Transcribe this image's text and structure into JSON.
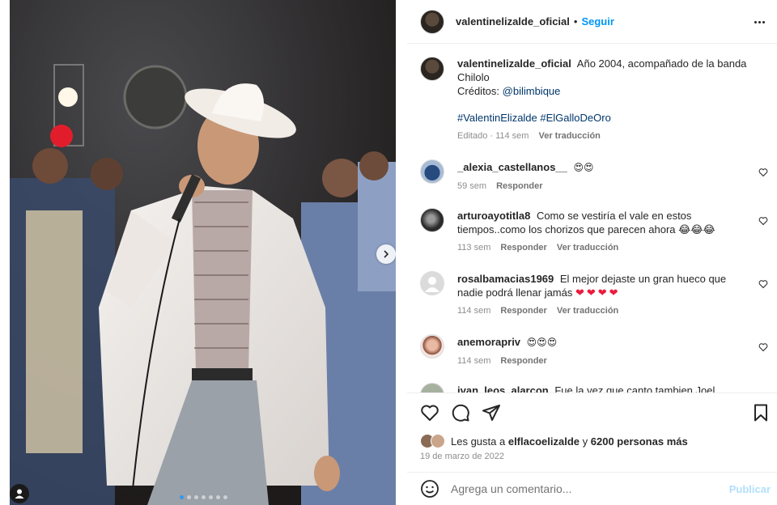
{
  "post": {
    "username": "valentinelizalde_oficial",
    "separator": "•",
    "follow_label": "Seguir"
  },
  "caption": {
    "username": "valentinelizalde_oficial",
    "text": "Año 2004, acompañado de la banda Chilolo",
    "credits_prefix": "Créditos:",
    "credits_handle": "@bilimbique",
    "hashtags": "#ValentinElizalde #ElGalloDeOro",
    "meta_time": "Editado · 114 sem",
    "meta_translate": "Ver traducción"
  },
  "comments": [
    {
      "username": "_alexia_castellanos__",
      "text": "😍😍",
      "time": "59 sem",
      "reply": "Responder",
      "translate": ""
    },
    {
      "username": "arturoayotitla8",
      "text": "Como se vestiría el vale en estos tiempos..como los chorizos que parecen ahora 😂😂😂",
      "time": "113 sem",
      "reply": "Responder",
      "translate": "Ver traducción"
    },
    {
      "username": "rosalbamacias1969",
      "text": "El mejor dejaste un gran hueco que nadie podrá llenar jamás",
      "hearts": "❤❤❤❤",
      "time": "114 sem",
      "reply": "Responder",
      "translate": "Ver traducción"
    },
    {
      "username": "anemorapriv",
      "text": "😍😍😍",
      "time": "114 sem",
      "reply": "Responder",
      "translate": ""
    },
    {
      "username": "ivan_leos_alarcon",
      "text": "Fue la vez que canto tambien Joel Elizalde?"
    }
  ],
  "likes": {
    "prefix": "Les gusta a",
    "user": "elflacoelizalde",
    "connector": "y",
    "count": "6200 personas más"
  },
  "date": "19 de marzo de 2022",
  "add_comment": {
    "placeholder": "Agrega un comentario...",
    "publish_label": "Publicar"
  },
  "carousel": {
    "total": 7,
    "active_index": 0
  },
  "colors": {
    "link_blue": "#0095f6",
    "hashtag": "#00376b",
    "publish_disabled": "#b2dffc",
    "carousel_active": "#3797f0"
  }
}
